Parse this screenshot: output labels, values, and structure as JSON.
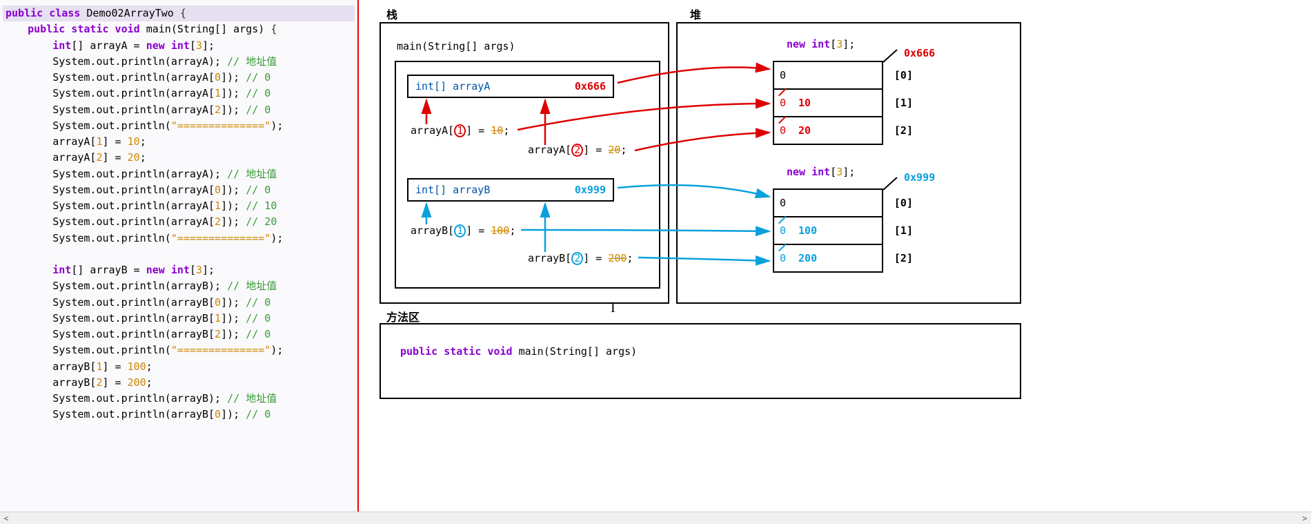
{
  "code": {
    "class_decl": "public class Demo02ArrayTwo {",
    "main_decl": "    public static void main(String[] args) {",
    "lines": [
      "        int[] arrayA = new int[3];",
      "        System.out.println(arrayA); // 地址值",
      "        System.out.println(arrayA[0]); // 0",
      "        System.out.println(arrayA[1]); // 0",
      "        System.out.println(arrayA[2]); // 0",
      "        System.out.println(\"==============\");",
      "        arrayA[1] = 10;",
      "        arrayA[2] = 20;",
      "        System.out.println(arrayA); // 地址值",
      "        System.out.println(arrayA[0]); // 0",
      "        System.out.println(arrayA[1]); // 10",
      "        System.out.println(arrayA[2]); // 20",
      "        System.out.println(\"==============\");",
      "",
      "        int[] arrayB = new int[3];",
      "        System.out.println(arrayB); // 地址值",
      "        System.out.println(arrayB[0]); // 0",
      "        System.out.println(arrayB[1]); // 0",
      "        System.out.println(arrayB[2]); // 0",
      "        System.out.println(\"==============\");",
      "        arrayB[1] = 100;",
      "        arrayB[2] = 200;",
      "        System.out.println(arrayB); // 地址值",
      "        System.out.println(arrayB[0]); // 0"
    ]
  },
  "diagram": {
    "stack_title": "栈",
    "heap_title": "堆",
    "method_title": "方法区",
    "main_label": "main(String[] args)",
    "arrayA_decl": "int[] arrayA",
    "arrayA_addr": "0x666",
    "arrayB_decl": "int[] arrayB",
    "arrayB_addr": "0x999",
    "assignA1_pre": "arrayA[",
    "assignA1_idx": "1",
    "assignA1_post": "] = ",
    "assignA1_val": "10",
    "assignA1_end": ";",
    "assignA2_pre": "arrayA[",
    "assignA2_idx": "2",
    "assignA2_post": "] = ",
    "assignA2_val": "20",
    "assignA2_end": ";",
    "assignB1_pre": "arrayB[",
    "assignB1_idx": "1",
    "assignB1_post": "] = ",
    "assignB1_val": "100",
    "assignB1_end": ";",
    "assignB2_pre": "arrayB[",
    "assignB2_idx": "2",
    "assignB2_post": "] = ",
    "assignB2_val": "200",
    "assignB2_end": ";",
    "new_int_1": "new int[3];",
    "heap_addr_1": "0x666",
    "new_int_2": "new int[3];",
    "heap_addr_2": "0x999",
    "heapA": {
      "cell0": "0",
      "idx0": "[0]",
      "cell1_old": "0",
      "cell1_new": "10",
      "idx1": "[1]",
      "cell2_old": "0",
      "cell2_new": "20",
      "idx2": "[2]"
    },
    "heapB": {
      "cell0": "0",
      "idx0": "[0]",
      "cell1_old": "0",
      "cell1_new": "100",
      "idx1": "[1]",
      "cell2_old": "0",
      "cell2_new": "200",
      "idx2": "[2]"
    },
    "method_text": "public static void main(String[] args)"
  },
  "chart_data": {
    "type": "diagram",
    "description": "Java memory model showing stack frames, heap arrays and method area",
    "stack": {
      "frame": "main(String[] args)",
      "vars": [
        {
          "name": "arrayA",
          "type": "int[]",
          "value_addr": "0x666",
          "assignments": [
            {
              "idx": 1,
              "val": 10
            },
            {
              "idx": 2,
              "val": 20
            }
          ]
        },
        {
          "name": "arrayB",
          "type": "int[]",
          "value_addr": "0x999",
          "assignments": [
            {
              "idx": 1,
              "val": 100
            },
            {
              "idx": 2,
              "val": 200
            }
          ]
        }
      ]
    },
    "heap": [
      {
        "addr": "0x666",
        "decl": "new int[3]",
        "values": [
          0,
          10,
          20
        ],
        "original": [
          0,
          0,
          0
        ]
      },
      {
        "addr": "0x999",
        "decl": "new int[3]",
        "values": [
          0,
          100,
          200
        ],
        "original": [
          0,
          0,
          0
        ]
      }
    ],
    "method_area": [
      "public static void main(String[] args)"
    ],
    "arrows": [
      {
        "from": "arrayA-addr",
        "to": "heap-0x666",
        "color": "red"
      },
      {
        "from": "arrayA[1]=10",
        "to": "heap-0x666-idx1",
        "color": "red"
      },
      {
        "from": "arrayA[2]=20",
        "to": "heap-0x666-idx2",
        "color": "red"
      },
      {
        "from": "arrayB-addr",
        "to": "heap-0x999",
        "color": "blue"
      },
      {
        "from": "arrayB[1]=100",
        "to": "heap-0x999-idx1",
        "color": "blue"
      },
      {
        "from": "arrayB[2]=200",
        "to": "heap-0x999-idx2",
        "color": "blue"
      }
    ]
  }
}
